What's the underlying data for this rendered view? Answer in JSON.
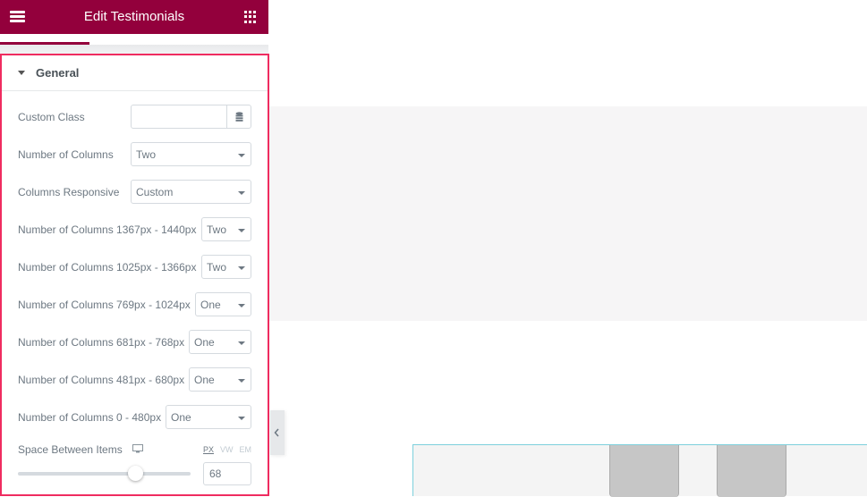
{
  "header": {
    "title": "Edit Testimonials",
    "menu_icon": "hamburger-icon",
    "apps_icon": "grid-icon"
  },
  "section": {
    "title": "General",
    "expanded": true
  },
  "controls": {
    "custom_class": {
      "label": "Custom Class",
      "value": "",
      "icon": "database-icon"
    },
    "num_columns": {
      "label": "Number of Columns",
      "value": "Two"
    },
    "columns_responsive": {
      "label": "Columns Responsive",
      "value": "Custom"
    },
    "cols_1367_1440": {
      "label": "Number of Columns 1367px - 1440px",
      "value": "Two"
    },
    "cols_1025_1366": {
      "label": "Number of Columns 1025px - 1366px",
      "value": "Two"
    },
    "cols_769_1024": {
      "label": "Number of Columns 769px - 1024px",
      "value": "One"
    },
    "cols_681_768": {
      "label": "Number of Columns 681px - 768px",
      "value": "One"
    },
    "cols_481_680": {
      "label": "Number of Columns 481px - 680px",
      "value": "One"
    },
    "cols_0_480": {
      "label": "Number of Columns 0 - 480px",
      "value": "One"
    },
    "space_between": {
      "label": "Space Between Items",
      "device_icon": "monitor-icon",
      "units": [
        "PX",
        "VW",
        "EM"
      ],
      "active_unit": "PX",
      "value": "68",
      "slider_fraction": 0.68
    }
  },
  "colors": {
    "brand": "#93003c",
    "highlight_border": "#ef2c60",
    "widget_outline": "#7dd0dc"
  }
}
